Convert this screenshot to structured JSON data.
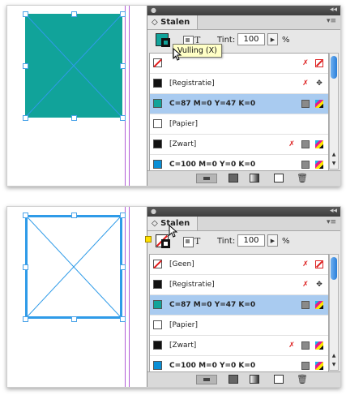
{
  "panel": {
    "tab_label": "◇ Stalen",
    "tint_label": "Tint:",
    "tint_value": "100",
    "tint_unit": "%"
  },
  "top": {
    "tooltip": "Vulling (X)",
    "swatches": [
      {
        "name": "",
        "icons": [
          "nonedit",
          "nonebox"
        ],
        "color": "none"
      },
      {
        "name": "[Registratie]",
        "icons": [
          "nonedit",
          "regmark"
        ],
        "color": "#111111"
      },
      {
        "name": "C=87 M=0 Y=47 K=0",
        "icons": [
          "gray",
          "cmyk"
        ],
        "color": "#11a39a",
        "selected": true
      },
      {
        "name": "[Papier]",
        "icons": [],
        "color": "#ffffff"
      },
      {
        "name": "[Zwart]",
        "icons": [
          "nonedit",
          "gray",
          "cmyk"
        ],
        "color": "#111111"
      },
      {
        "name": "C=100 M=0 Y=0 K=0",
        "icons": [
          "gray",
          "cmyk"
        ],
        "color": "#0a8fd6"
      }
    ]
  },
  "bottom": {
    "swatches": [
      {
        "name": "[Geen]",
        "icons": [
          "nonedit",
          "nonebox"
        ],
        "color": "none"
      },
      {
        "name": "[Registratie]",
        "icons": [
          "nonedit",
          "regmark"
        ],
        "color": "#111111"
      },
      {
        "name": "C=87 M=0 Y=47 K=0",
        "icons": [
          "gray",
          "cmyk"
        ],
        "color": "#11a39a",
        "selected": true
      },
      {
        "name": "[Papier]",
        "icons": [],
        "color": "#ffffff"
      },
      {
        "name": "[Zwart]",
        "icons": [
          "nonedit",
          "gray",
          "cmyk"
        ],
        "color": "#111111"
      },
      {
        "name": "C=100 M=0 Y=0 K=0",
        "icons": [
          "gray",
          "cmyk"
        ],
        "color": "#0a8fd6"
      }
    ]
  },
  "colors": {
    "teal": "#11a39a",
    "frame_blue": "#2f9be8",
    "guide": "#b15cd6",
    "selection": "#a9cbf0"
  },
  "icons": [
    "close-icon",
    "panel-collapse-icon",
    "panel-menu-icon",
    "fill-swatch-icon",
    "stroke-swatch-icon",
    "container-format-icon",
    "text-format-icon",
    "tint-stepper-icon",
    "non-editable-icon",
    "registration-icon",
    "process-cmyk-icon",
    "spot-gray-icon",
    "show-swatches-icon",
    "new-color-icon",
    "gradient-icon",
    "new-swatch-icon",
    "trash-icon",
    "pointer-icon"
  ]
}
